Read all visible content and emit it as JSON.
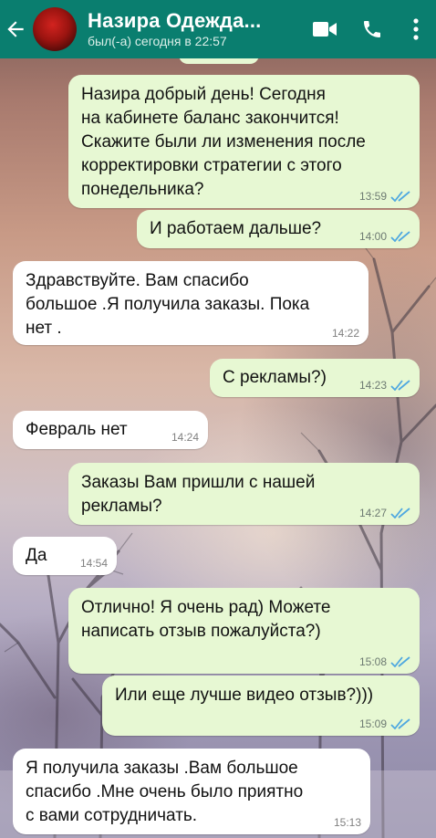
{
  "header": {
    "contact_name": "Назира Одежда...",
    "last_seen": "был(-а) сегодня в 22:57",
    "back_icon": "back-arrow-icon",
    "video_icon": "video-call-icon",
    "call_icon": "phone-call-icon",
    "menu_icon": "more-vert-icon",
    "color": "#0a7e6f"
  },
  "colors": {
    "outgoing_bubble": "#e7f8d3",
    "incoming_bubble": "#ffffff",
    "read_ticks": "#4fa8e0"
  },
  "messages": [
    {
      "direction": "out",
      "text": "Назира добрый день! Сегодня\nна кабинете баланс закончится!\nСкажите были ли изменения после\nкорректировки стратегии с этого\nпонедельника?",
      "time": "13:59",
      "status": "read"
    },
    {
      "direction": "out",
      "text": "И работаем дальше?",
      "time": "14:00",
      "status": "read"
    },
    {
      "direction": "in",
      "text": "Здравствуйте. Вам спасибо\nбольшое .Я получила заказы. Пока\nнет .",
      "time": "14:22"
    },
    {
      "direction": "out",
      "text": "С рекламы?)",
      "time": "14:23",
      "status": "read"
    },
    {
      "direction": "in",
      "text": "Февраль нет",
      "time": "14:24"
    },
    {
      "direction": "out",
      "text": "Заказы Вам пришли с нашей\nрекламы?",
      "time": "14:27",
      "status": "read"
    },
    {
      "direction": "in",
      "text": "Да",
      "time": "14:54"
    },
    {
      "direction": "out",
      "text": "Отлично! Я очень рад) Можете\nнаписать отзыв пожалуйста?)",
      "time": "15:08",
      "status": "read"
    },
    {
      "direction": "out",
      "text": "Или еще лучше видео отзыв?)))",
      "time": "15:09",
      "status": "read"
    },
    {
      "direction": "in",
      "text": "Я получила заказы .Вам большое\nспасибо .Мне очень было приятно\nс вами сотрудничать.",
      "time": "15:13"
    }
  ]
}
